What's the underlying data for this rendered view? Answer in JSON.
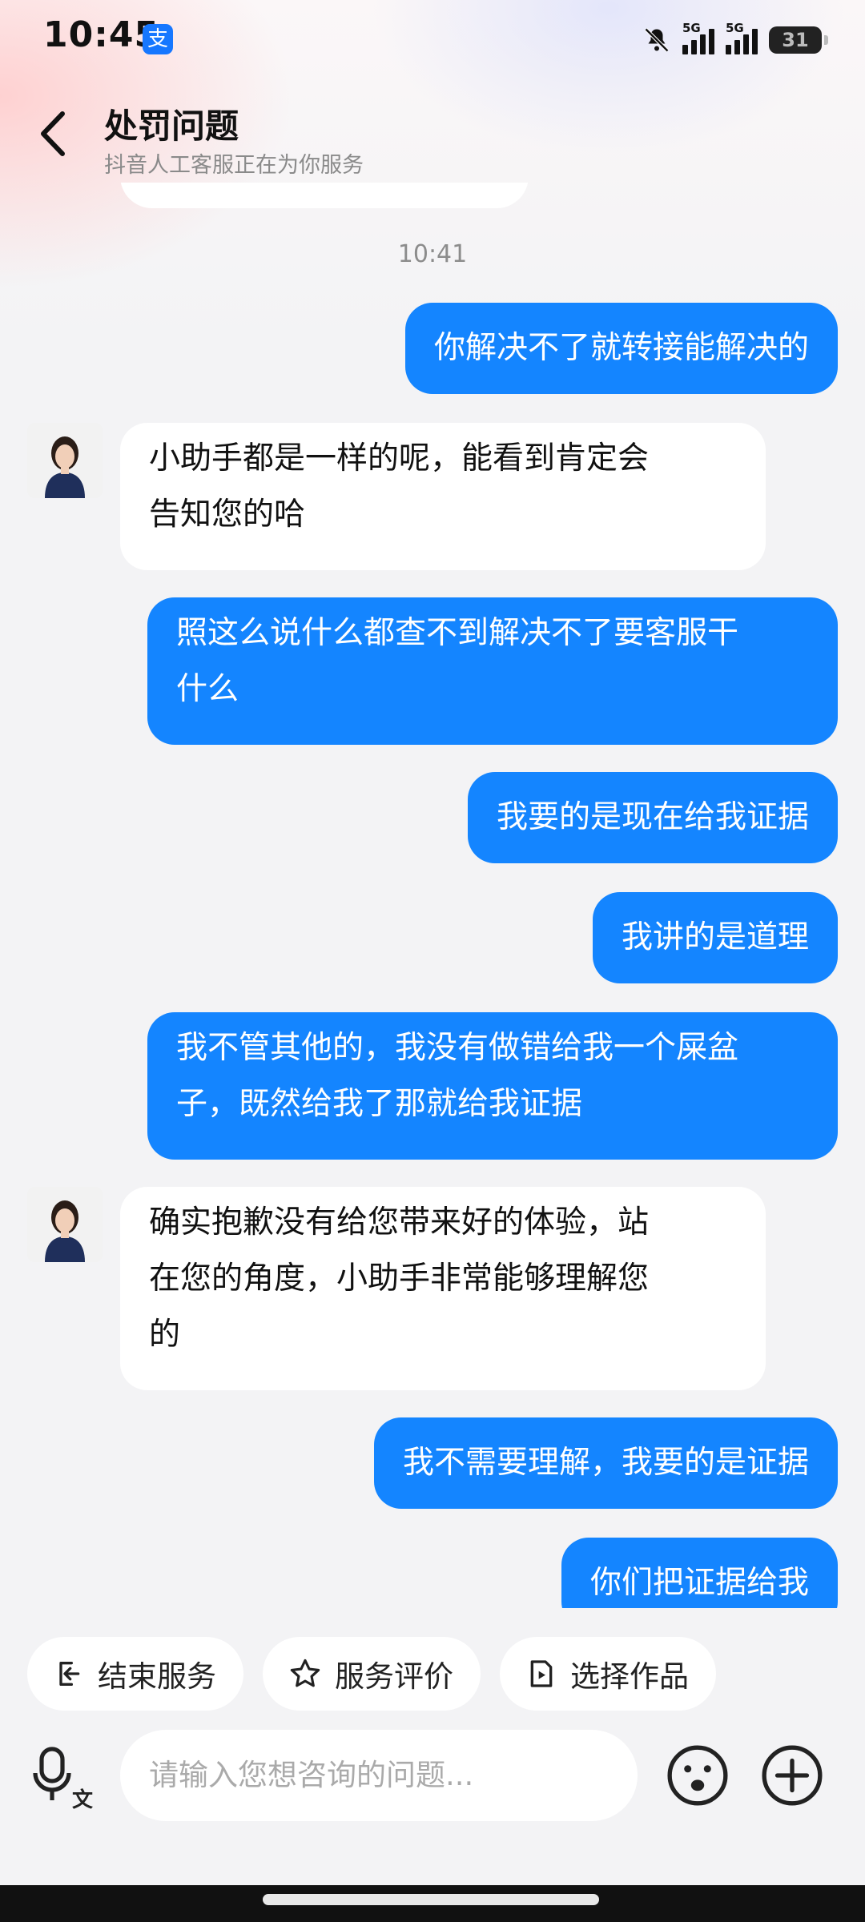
{
  "status_bar": {
    "time": "10:45",
    "app_icon": "alipay-icon",
    "network_1": "5G",
    "network_2": "5G",
    "battery": "31"
  },
  "header": {
    "title": "处罚问题",
    "subtitle": "抖音人工客服正在为你服务",
    "back_icon": "chevron-left-icon"
  },
  "chat": {
    "timestamp": "10:41",
    "messages": [
      {
        "side": "out",
        "lines": [
          "你解决不了就转接能解决的"
        ]
      },
      {
        "side": "in",
        "lines": [
          "小助手都是一样的呢，能看到肯定会",
          "告知您的哈"
        ]
      },
      {
        "side": "out",
        "lines": [
          "照这么说什么都查不到解决不了要客服干",
          "什么"
        ]
      },
      {
        "side": "out",
        "lines": [
          "我要的是现在给我证据"
        ]
      },
      {
        "side": "out",
        "lines": [
          "我讲的是道理"
        ]
      },
      {
        "side": "out",
        "lines": [
          "我不管其他的，我没有做错给我一个屎盆",
          "子，既然给我了那就给我证据"
        ]
      },
      {
        "side": "in",
        "lines": [
          "确实抱歉没有给您带来好的体验，站",
          "在您的角度，小助手非常能够理解您",
          "的"
        ]
      },
      {
        "side": "out",
        "lines": [
          "我不需要理解，我要的是证据"
        ]
      },
      {
        "side": "out",
        "lines": [
          "你们把证据给我"
        ]
      }
    ]
  },
  "quick_actions": [
    {
      "label": "结束服务",
      "icon": "exit-icon"
    },
    {
      "label": "服务评价",
      "icon": "star-icon"
    },
    {
      "label": "选择作品",
      "icon": "video-select-icon"
    }
  ],
  "input": {
    "placeholder": "请输入您想咨询的问题...",
    "voice_icon": "voice-to-text-icon",
    "emoji_icon": "emoji-icon",
    "plus_icon": "plus-icon"
  },
  "colors": {
    "outgoing_bubble": "#1485ff",
    "incoming_bubble": "#ffffff",
    "background": "#f3f3f5"
  }
}
